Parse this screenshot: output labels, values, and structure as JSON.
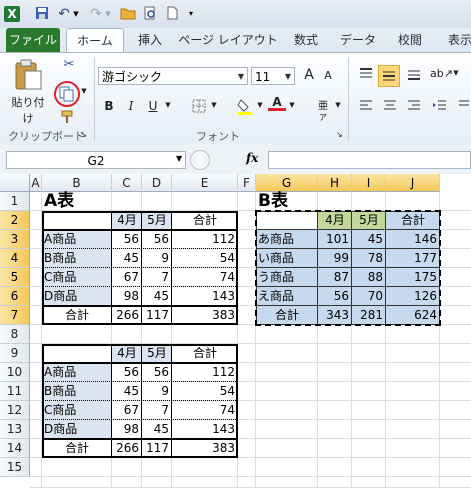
{
  "qat": {
    "excel_letter": "X",
    "undo_glyph": "↶",
    "redo_glyph": "↷",
    "icons": [
      "save-icon",
      "undo-icon",
      "redo-icon",
      "open-folder-icon",
      "print-preview-icon",
      "new-document-icon",
      "customize-qat-icon"
    ]
  },
  "tabs": [
    "ファイル",
    "ホーム",
    "挿入",
    "ページ レイアウト",
    "数式",
    "データ",
    "校閲",
    "表示"
  ],
  "ribbon": {
    "paste_label": "貼り付け",
    "clipboard_group": "クリップボード",
    "font_group": "フォント",
    "font_name": "游ゴシック",
    "font_size": "11",
    "bold": "B",
    "italic": "I",
    "underline": "U",
    "grow_font": "A",
    "shrink_font": "A",
    "font_color_glyph": "A"
  },
  "formula_bar": {
    "name_box": "G2",
    "fx": "fx",
    "formula": ""
  },
  "columns": [
    "A",
    "B",
    "C",
    "D",
    "E",
    "F",
    "G",
    "H",
    "I",
    "J"
  ],
  "rows": [
    "1",
    "2",
    "3",
    "4",
    "5",
    "6",
    "7",
    "8",
    "9",
    "10",
    "11",
    "12",
    "13",
    "14",
    "15"
  ],
  "table_a": {
    "title": "A表",
    "header": [
      "4月",
      "5月",
      "合計"
    ],
    "rows": [
      {
        "name": "A商品",
        "apr": "56",
        "may": "56",
        "total": "112"
      },
      {
        "name": "B商品",
        "apr": "45",
        "may": "9",
        "total": "54"
      },
      {
        "name": "C商品",
        "apr": "67",
        "may": "7",
        "total": "74"
      },
      {
        "name": "D商品",
        "apr": "98",
        "may": "45",
        "total": "143"
      }
    ],
    "total_row": {
      "name": "合計",
      "apr": "266",
      "may": "117",
      "total": "383"
    }
  },
  "table_b": {
    "title": "B表",
    "header": [
      "4月",
      "5月",
      "合計"
    ],
    "rows": [
      {
        "name": "あ商品",
        "apr": "101",
        "may": "45",
        "total": "146"
      },
      {
        "name": "い商品",
        "apr": "99",
        "may": "78",
        "total": "177"
      },
      {
        "name": "う商品",
        "apr": "87",
        "may": "88",
        "total": "175"
      },
      {
        "name": "え商品",
        "apr": "56",
        "may": "70",
        "total": "126"
      }
    ],
    "total_row": {
      "name": "合計",
      "apr": "343",
      "may": "281",
      "total": "624"
    }
  },
  "table_c": {
    "header": [
      "4月",
      "5月",
      "合計"
    ],
    "rows": [
      {
        "name": "A商品",
        "apr": "56",
        "may": "56",
        "total": "112"
      },
      {
        "name": "B商品",
        "apr": "45",
        "may": "9",
        "total": "54"
      },
      {
        "name": "C商品",
        "apr": "67",
        "may": "7",
        "total": "74"
      },
      {
        "name": "D商品",
        "apr": "98",
        "may": "45",
        "total": "143"
      }
    ],
    "total_row": {
      "name": "合計",
      "apr": "266",
      "may": "117",
      "total": "383"
    }
  },
  "colors": {
    "file_tab": "#2a7a2e",
    "selection": "#c6d9ef",
    "header_fill": "#dbe5f1",
    "b_header_fill": "#c4d79b",
    "accent_circle": "#e0202a"
  }
}
